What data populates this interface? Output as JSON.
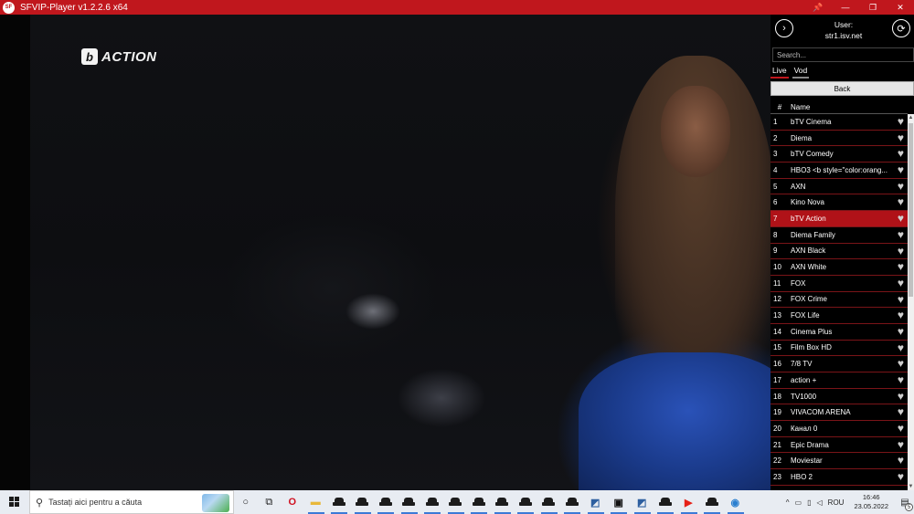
{
  "window": {
    "title": "SFVIP-Player v1.2.2.6 x64",
    "app_icon_text": "SF",
    "controls": {
      "pin": "📌",
      "minimize": "—",
      "maximize": "❐",
      "close": "✕"
    },
    "accent_color": "#c0171d"
  },
  "video": {
    "channel_logo_letter": "b",
    "channel_logo_text": "ACTION"
  },
  "panel": {
    "next_icon": "›",
    "refresh_icon": "⟳",
    "user_label": "User:",
    "user_value": "str1.isv.net",
    "search_placeholder": "Search...",
    "tabs": [
      {
        "label": "Live"
      },
      {
        "label": "Vod"
      }
    ],
    "back_label": "Back",
    "columns": {
      "num": "#",
      "name": "Name"
    },
    "channels": [
      {
        "num": "1",
        "name": "bTV Cinema"
      },
      {
        "num": "2",
        "name": "Diema"
      },
      {
        "num": "3",
        "name": "bTV Comedy"
      },
      {
        "num": "4",
        "name": "HBO3 <b style=\"color:orang..."
      },
      {
        "num": "5",
        "name": "AXN"
      },
      {
        "num": "6",
        "name": "Kino Nova"
      },
      {
        "num": "7",
        "name": "bTV Action"
      },
      {
        "num": "8",
        "name": "Diema Family"
      },
      {
        "num": "9",
        "name": "AXN Black"
      },
      {
        "num": "10",
        "name": "AXN White"
      },
      {
        "num": "11",
        "name": "FOX"
      },
      {
        "num": "12",
        "name": "FOX Crime"
      },
      {
        "num": "13",
        "name": "FOX Life"
      },
      {
        "num": "14",
        "name": "Cinema Plus"
      },
      {
        "num": "15",
        "name": "Film Box HD"
      },
      {
        "num": "16",
        "name": "7/8 TV"
      },
      {
        "num": "17",
        "name": "action +"
      },
      {
        "num": "18",
        "name": "TV1000"
      },
      {
        "num": "19",
        "name": "VIVACOM ARENA"
      },
      {
        "num": "20",
        "name": "Канал 0"
      },
      {
        "num": "21",
        "name": "Epic Drama"
      },
      {
        "num": "22",
        "name": "Moviestar"
      },
      {
        "num": "23",
        "name": "HBO 2"
      }
    ],
    "selected_channel_num": "7",
    "fav_icon": "♥"
  },
  "taskbar": {
    "search_placeholder": "Tastați aici pentru a căuta",
    "search_icon": "⚲",
    "cortana_icon": "○",
    "taskview_icon": "⧉",
    "apps": [
      {
        "name": "opera-icon",
        "glyph": "O",
        "color": "#d01020",
        "active": false
      },
      {
        "name": "file-explorer-icon",
        "glyph": "▬",
        "color": "#e8b83a",
        "active": true
      },
      {
        "name": "incognito-icon",
        "glyph": "",
        "color": "#1c1c1c",
        "active": true
      },
      {
        "name": "incognito-icon",
        "glyph": "",
        "color": "#1c1c1c",
        "active": true
      },
      {
        "name": "incognito-icon",
        "glyph": "",
        "color": "#1c1c1c",
        "active": true
      },
      {
        "name": "incognito-icon",
        "glyph": "",
        "color": "#1c1c1c",
        "active": true
      },
      {
        "name": "incognito-icon",
        "glyph": "",
        "color": "#1c1c1c",
        "active": true
      },
      {
        "name": "incognito-icon",
        "glyph": "",
        "color": "#1c1c1c",
        "active": true
      },
      {
        "name": "incognito-icon",
        "glyph": "",
        "color": "#1c1c1c",
        "active": true
      },
      {
        "name": "incognito-icon",
        "glyph": "",
        "color": "#1c1c1c",
        "active": true
      },
      {
        "name": "incognito-icon",
        "glyph": "",
        "color": "#1c1c1c",
        "active": true
      },
      {
        "name": "incognito-icon",
        "glyph": "",
        "color": "#1c1c1c",
        "active": true
      },
      {
        "name": "incognito-icon",
        "glyph": "",
        "color": "#1c1c1c",
        "active": true
      },
      {
        "name": "python-icon",
        "glyph": "◩",
        "color": "#2d5fa0",
        "active": true
      },
      {
        "name": "terminal-icon",
        "glyph": "▣",
        "color": "#111111",
        "active": true
      },
      {
        "name": "python-icon",
        "glyph": "◩",
        "color": "#2d5fa0",
        "active": true
      },
      {
        "name": "incognito-icon",
        "glyph": "",
        "color": "#1c1c1c",
        "active": true
      },
      {
        "name": "youtube-icon",
        "glyph": "▶",
        "color": "#e62117",
        "active": true
      },
      {
        "name": "incognito-icon",
        "glyph": "",
        "color": "#1c1c1c",
        "active": true
      },
      {
        "name": "sfvip-icon",
        "glyph": "◉",
        "color": "#2a7fd0",
        "active": true
      }
    ],
    "tray": {
      "chevron": "^",
      "network_icon": "▭",
      "battery_icon": "▯",
      "volume_icon": "◁",
      "language": "ROU",
      "time": "16:46",
      "date": "23.05.2022",
      "notifications_icon": "▤",
      "notifications_count": "5"
    }
  }
}
